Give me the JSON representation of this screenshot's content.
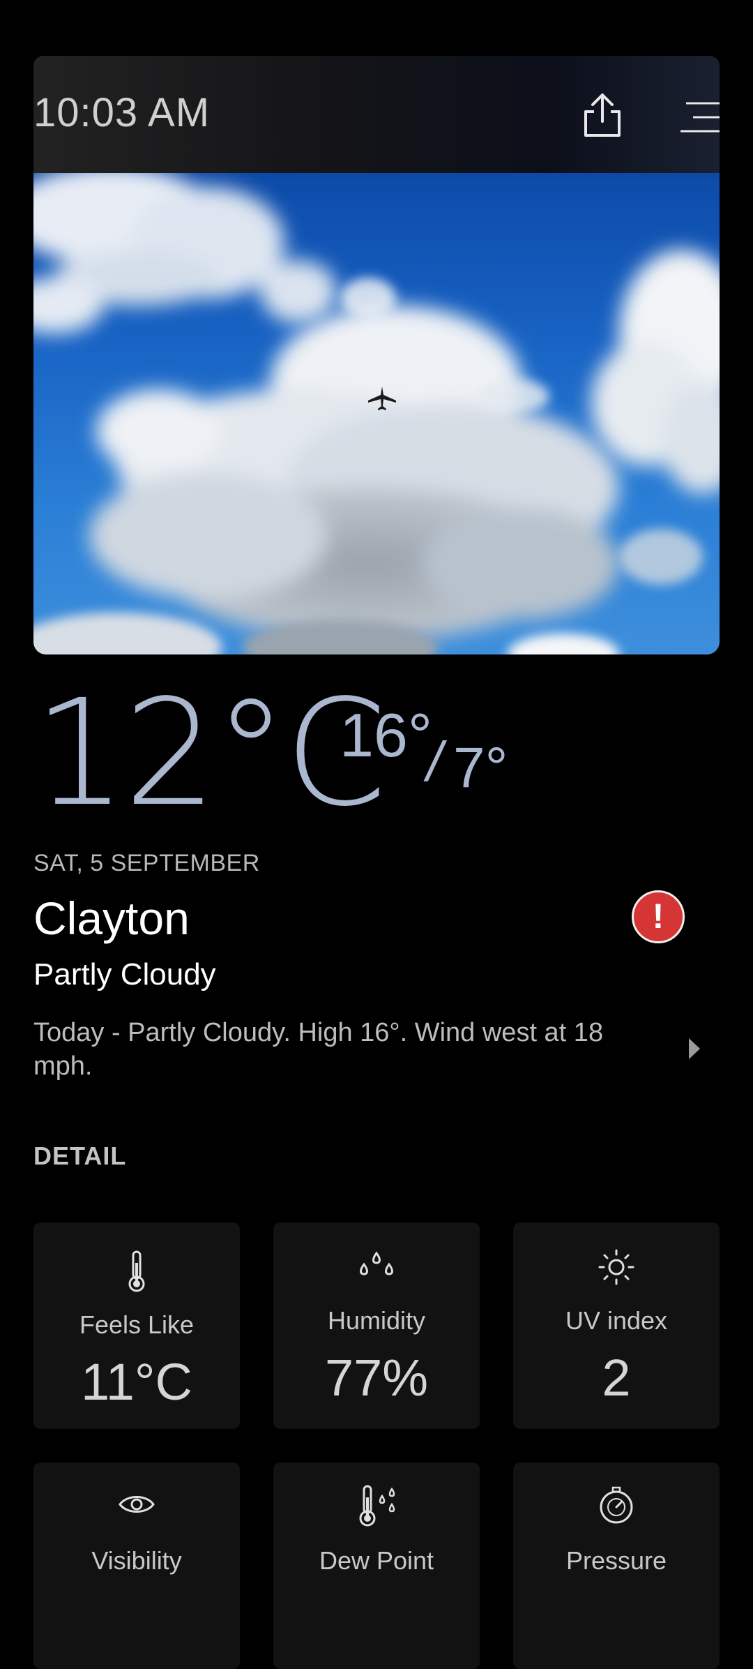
{
  "header": {
    "time": "10:03 AM",
    "share_icon": "share-icon",
    "menu_icon": "menu-icon"
  },
  "weather": {
    "current_temp": "12°C",
    "high": "16°",
    "separator": "/",
    "low": "7°",
    "date": "SAT, 5 SEPTEMBER",
    "city": "Clayton",
    "alert_symbol": "!",
    "condition": "Partly Cloudy",
    "forecast": "Today - Partly Cloudy. High 16°. Wind west at 18 mph."
  },
  "detail": {
    "title": "DETAIL",
    "cards": [
      {
        "label": "Feels Like",
        "value": "11°C",
        "icon": "thermometer-icon"
      },
      {
        "label": "Humidity",
        "value": "77%",
        "icon": "humidity-drops-icon"
      },
      {
        "label": "UV index",
        "value": "2",
        "icon": "sun-icon"
      },
      {
        "label": "Visibility",
        "value": "",
        "icon": "eye-icon"
      },
      {
        "label": "Dew Point",
        "value": "",
        "icon": "dew-point-icon"
      },
      {
        "label": "Pressure",
        "value": "",
        "icon": "pressure-gauge-icon"
      }
    ]
  },
  "colors": {
    "background": "#000000",
    "accent_temp": "#aab7cf",
    "alert": "#d63535",
    "card_bg": "#121212"
  }
}
